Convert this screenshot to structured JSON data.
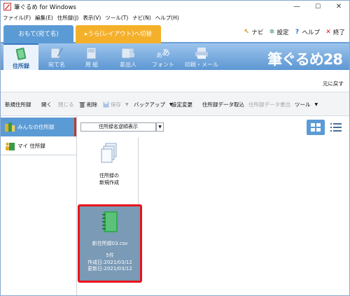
{
  "window": {
    "title": "筆ぐるめ for Windows",
    "minimize": "—",
    "maximize": "☐",
    "close": "✕"
  },
  "menu": [
    "ファイル(F)",
    "編集(E)",
    "住所録(J)",
    "表示(V)",
    "ツール(T)",
    "ナビ(N)",
    "ヘルプ(H)"
  ],
  "sides": {
    "front": "おもて(宛て名)",
    "back": "▸うら(レイアウト)へ切替"
  },
  "top_links": {
    "navi": "ナビ",
    "settings": "設定",
    "help": "ヘルプ",
    "exit": "終了"
  },
  "ribbon": {
    "tabs": [
      "住所録",
      "宛て名",
      "用 紙",
      "差出人",
      "フォント",
      "印刷・メール"
    ],
    "active_index": 0,
    "brand": "筆ぐるめ28"
  },
  "revert": "元に戻す",
  "toolbar": {
    "new_book": "新規住所録",
    "open": "開く",
    "close": "閉じる",
    "delete": "削除",
    "save": "保存",
    "backup": "バックアップ",
    "settings_change": "設定変更",
    "import": "住所録データ取込",
    "export": "住所録データ書出",
    "tools": "ツール"
  },
  "left_pane": {
    "items": [
      "みんなの住所録",
      "マイ 住所録"
    ]
  },
  "main": {
    "sort_label": "住所録名逆順表示",
    "new_card": {
      "line1": "住所録の",
      "line2": "新規作成"
    },
    "file_card": {
      "name": "新住所録03.csv",
      "count": "5件",
      "created": "作成日:2021/03/12",
      "updated": "更新日:2021/03/12"
    }
  },
  "colors": {
    "accent_blue": "#5b9bd5",
    "back_orange": "#f5b02a",
    "highlight_red": "#e8141b"
  }
}
